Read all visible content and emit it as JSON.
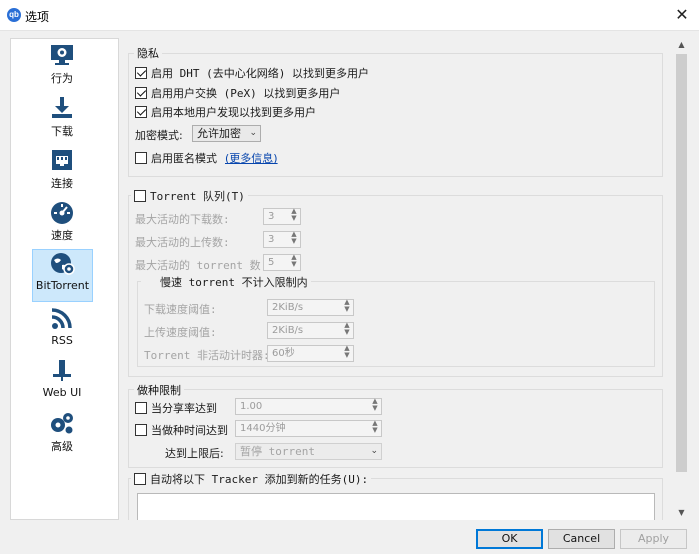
{
  "window": {
    "title": "选项",
    "app_icon_text": "qb"
  },
  "sidebar": {
    "items": [
      {
        "label": "行为",
        "icon": "monitor-gear-icon"
      },
      {
        "label": "下载",
        "icon": "download-icon"
      },
      {
        "label": "连接",
        "icon": "network-port-icon"
      },
      {
        "label": "速度",
        "icon": "speedometer-icon"
      },
      {
        "label": "BitTorrent",
        "icon": "globe-gear-icon",
        "selected": true
      },
      {
        "label": "RSS",
        "icon": "rss-icon"
      },
      {
        "label": "Web UI",
        "icon": "webui-icon"
      },
      {
        "label": "高级",
        "icon": "gears-icon"
      }
    ]
  },
  "privacy": {
    "title": "隐私",
    "dht": {
      "label": "启用 DHT (去中心化网络) 以找到更多用户",
      "checked": true
    },
    "pex": {
      "label": "启用用户交换 (PeX) 以找到更多用户",
      "checked": true
    },
    "lsd": {
      "label": "启用本地用户发现以找到更多用户",
      "checked": true
    },
    "encryption_label": "加密模式:",
    "encryption_value": "允许加密",
    "anonymous": {
      "label": "启用匿名模式",
      "checked": false,
      "link": "(更多信息)"
    }
  },
  "queue": {
    "title": "Torrent 队列(T)",
    "checked": false,
    "max_downloads_label": "最大活动的下载数:",
    "max_downloads_value": "3",
    "max_uploads_label": "最大活动的上传数:",
    "max_uploads_value": "3",
    "max_torrents_label": "最大活动的 torrent 数:",
    "max_torrents_value": "5",
    "slow": {
      "title": "慢速 torrent 不计入限制内",
      "checked": false,
      "download_label": "下载速度阈值:",
      "download_value": "2KiB/s",
      "upload_label": "上传速度阈值:",
      "upload_value": "2KiB/s",
      "inactive_label": "Torrent 非活动计时器:",
      "inactive_value": "60秒"
    }
  },
  "seeding": {
    "title": "做种限制",
    "ratio": {
      "label": "当分享率达到",
      "checked": false,
      "value": "1.00"
    },
    "time": {
      "label": "当做种时间达到",
      "checked": false,
      "value": "1440分钟"
    },
    "action_label": "达到上限后:",
    "action_value": "暂停 torrent"
  },
  "trackers": {
    "label": "自动将以下 Tracker 添加到新的任务(U):",
    "checked": false
  },
  "buttons": {
    "ok": "OK",
    "cancel": "Cancel",
    "apply": "Apply"
  }
}
